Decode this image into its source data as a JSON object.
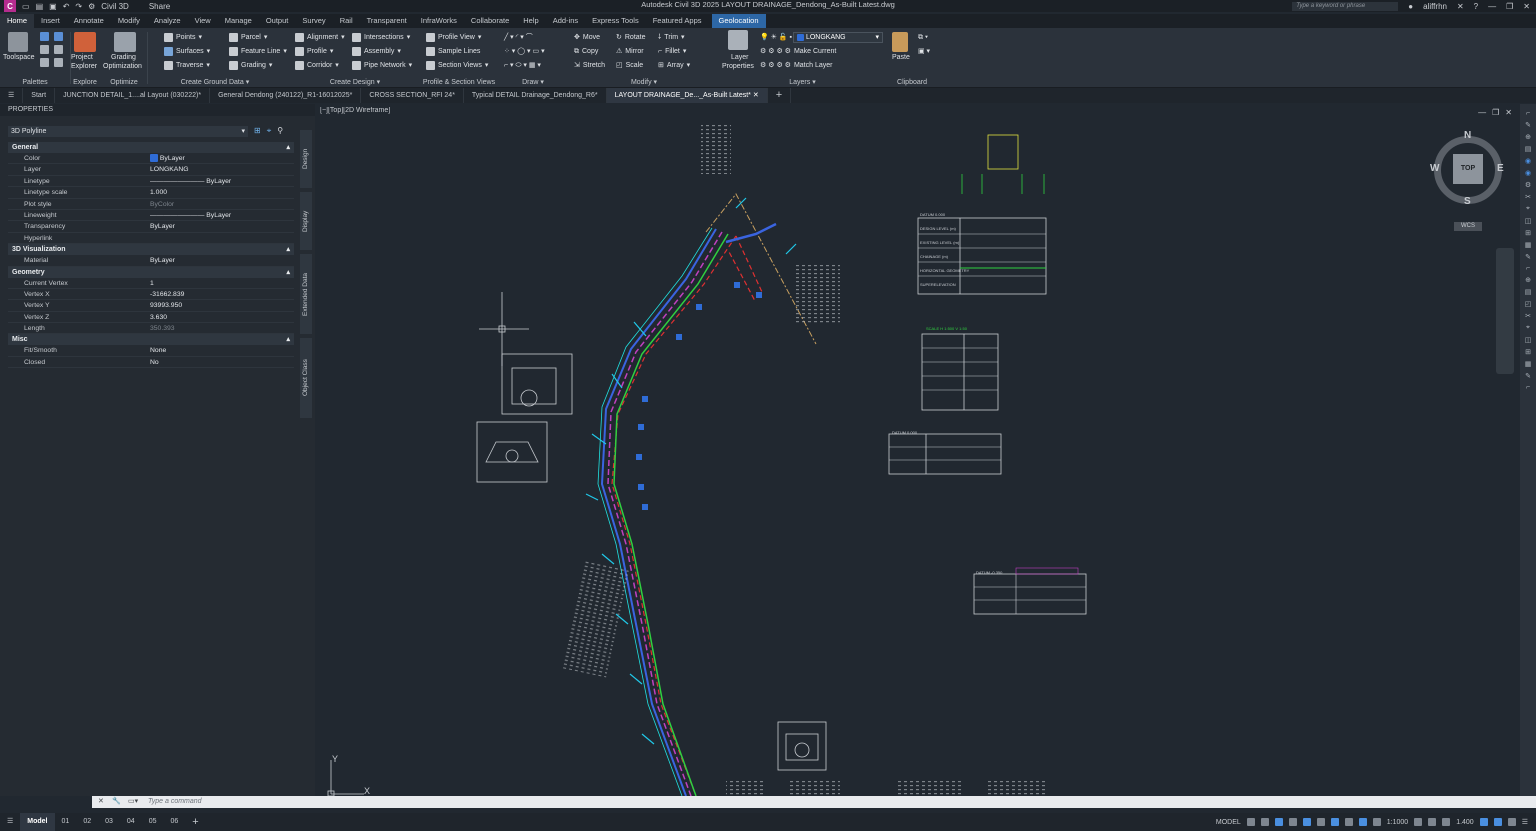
{
  "titlebar": {
    "app_letter": "C",
    "workspace": "Civil 3D",
    "share": "Share",
    "title": "Autodesk Civil 3D 2025   LAYOUT DRAINAGE_Dendong_As-Built Latest.dwg",
    "search_placeholder": "Type a keyword or phrase",
    "user": "aliffrhn"
  },
  "menu_tabs": [
    "Home",
    "Insert",
    "Annotate",
    "Modify",
    "Analyze",
    "View",
    "Manage",
    "Output",
    "Survey",
    "Rail",
    "Transparent",
    "InfraWorks",
    "Collaborate",
    "Help",
    "Add-ins",
    "Express Tools",
    "Featured Apps",
    "Geolocation"
  ],
  "ribbon": {
    "palettes": {
      "toolspace": "Toolspace",
      "label": "Palettes"
    },
    "explore": {
      "btn1": "Project",
      "btn2": "Explorer",
      "label": "Explore"
    },
    "optimize": {
      "btn1": "Grading",
      "btn2": "Optimization",
      "label": "Optimize"
    },
    "ground": {
      "points": "Points",
      "surfaces": "Surfaces",
      "traverse": "Traverse",
      "parcel": "Parcel",
      "feature_line": "Feature Line",
      "grading": "Grading",
      "label": "Create Ground Data"
    },
    "design": {
      "alignment": "Alignment",
      "profile": "Profile",
      "corridor": "Corridor",
      "intersections": "Intersections",
      "assembly": "Assembly",
      "pipe_network": "Pipe Network",
      "label": "Create Design"
    },
    "profile_section": {
      "profile_view": "Profile View",
      "sample_lines": "Sample Lines",
      "section_views": "Section Views",
      "label": "Profile & Section Views"
    },
    "draw": {
      "label": "Draw"
    },
    "modify": {
      "move": "Move",
      "rotate": "Rotate",
      "trim": "Trim",
      "copy": "Copy",
      "mirror": "Mirror",
      "fillet": "Fillet",
      "stretch": "Stretch",
      "scale": "Scale",
      "array": "Array",
      "label": "Modify"
    },
    "layers": {
      "btn1": "Layer",
      "btn2": "Properties",
      "current_layer": "LONGKANG",
      "make_current": "Make Current",
      "match_layer": "Match Layer",
      "label": "Layers"
    },
    "clipboard": {
      "paste": "Paste",
      "label": "Clipboard"
    }
  },
  "doc_tabs": [
    "Start",
    "JUNCTION DETAIL_1....al Layout (030222)*",
    "General Dendong (240122)_R1-16012025*",
    "CROSS SECTION_RFI 24*",
    "Typical DETAIL Drainage_Dendong_R6*",
    "LAYOUT DRAINAGE_De..._As-Built Latest*"
  ],
  "properties": {
    "header": "PROPERTIES",
    "object_type": "3D Polyline",
    "general": {
      "title": "General",
      "rows": [
        [
          "Color",
          "ByLayer"
        ],
        [
          "Layer",
          "LONGKANG"
        ],
        [
          "Linetype",
          "ByLayer"
        ],
        [
          "Linetype scale",
          "1.000"
        ],
        [
          "Plot style",
          "ByColor"
        ],
        [
          "Lineweight",
          "ByLayer"
        ],
        [
          "Transparency",
          "ByLayer"
        ],
        [
          "Hyperlink",
          ""
        ]
      ]
    },
    "viz": {
      "title": "3D Visualization",
      "rows": [
        [
          "Material",
          "ByLayer"
        ]
      ]
    },
    "geometry": {
      "title": "Geometry",
      "rows": [
        [
          "Current Vertex",
          "1"
        ],
        [
          "Vertex X",
          "-31662.839"
        ],
        [
          "Vertex Y",
          "93993.950"
        ],
        [
          "Vertex Z",
          "3.630"
        ],
        [
          "Length",
          "350.393"
        ]
      ]
    },
    "misc": {
      "title": "Misc",
      "rows": [
        [
          "Fit/Smooth",
          "None"
        ],
        [
          "Closed",
          "No"
        ]
      ]
    },
    "side_tabs": [
      "Design",
      "Display",
      "Extended Data",
      "Object Class"
    ]
  },
  "viewport": {
    "label": "[−][Top][2D Wireframe]",
    "viewcube": {
      "n": "N",
      "s": "S",
      "e": "E",
      "w": "W",
      "face": "TOP",
      "ucs": "WCS"
    },
    "axis_y": "Y",
    "axis_x": "X",
    "table1_rows": [
      "DESIGN LEVEL (m)",
      "EXISTING LEVEL (m)",
      "CHAINAGE (m)",
      "HORIZONTAL GEOMETRY",
      "SUPERELEVATION"
    ],
    "table1_datum": "DATUM 0.000",
    "table2_title": "SCALE H 1:500 V 1:50",
    "table3_datum": "DATUM 0.000",
    "table4_datum": "DATUM -0.350"
  },
  "command": {
    "placeholder": "Type a command"
  },
  "status": {
    "layout_tabs": [
      "Model",
      "01",
      "02",
      "03",
      "04",
      "05",
      "06"
    ],
    "model": "MODEL",
    "scale": "1:1000",
    "lineweight": "1.400"
  },
  "colors": {
    "accent": "#2d67a6",
    "app": "#b52c8e",
    "bg": "#212830"
  }
}
